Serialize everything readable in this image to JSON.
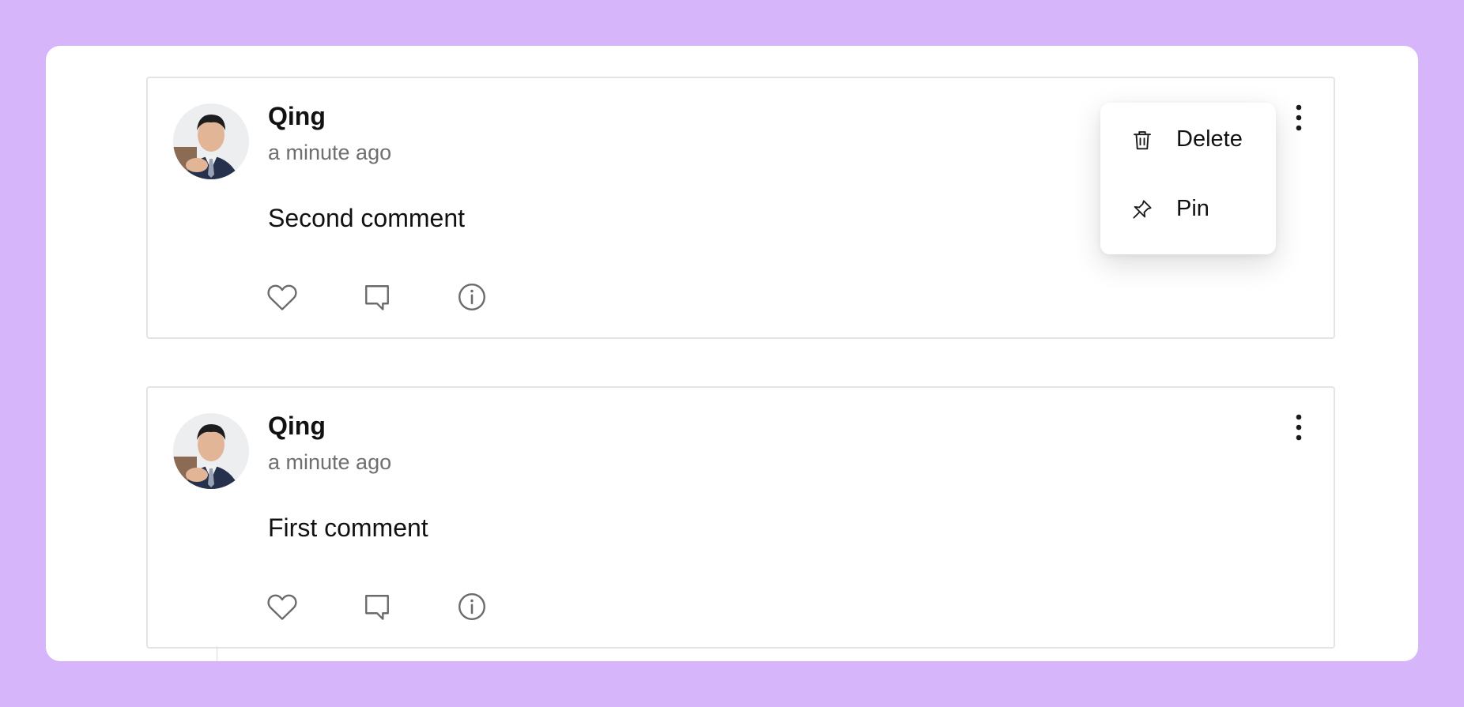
{
  "comments": [
    {
      "author": "Qing",
      "time": "a minute ago",
      "text": "Second comment",
      "menu_open": true
    },
    {
      "author": "Qing",
      "time": "a minute ago",
      "text": "First comment",
      "menu_open": false
    }
  ],
  "menu": {
    "items": [
      {
        "label": "Delete",
        "icon": "trash-icon"
      },
      {
        "label": "Pin",
        "icon": "pin-icon"
      }
    ]
  },
  "colors": {
    "background": "#d7b5fa",
    "panel": "#ffffff",
    "muted_text": "#6f6f6f",
    "icon": "#6b6b6b"
  }
}
